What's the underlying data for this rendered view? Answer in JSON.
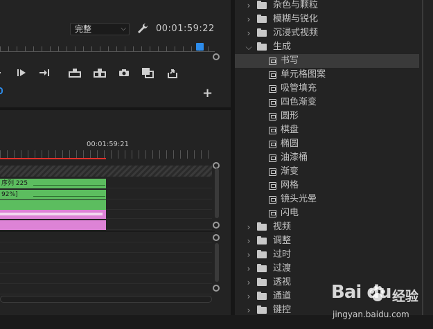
{
  "program_monitor": {
    "fit_value": "完整",
    "timecode": "00:01:59:22"
  },
  "timeline": {
    "timecode": "00:01:59:21",
    "video_clip_label": "序列 225",
    "video_clip_label2": "92%]"
  },
  "effects_tree": {
    "items": [
      {
        "label": "杂色与颗粒",
        "type": "folder",
        "expanded": false
      },
      {
        "label": "模糊与锐化",
        "type": "folder",
        "expanded": false
      },
      {
        "label": "沉浸式视频",
        "type": "folder",
        "expanded": false
      },
      {
        "label": "生成",
        "type": "folder",
        "expanded": true
      },
      {
        "label": "书写",
        "type": "effect",
        "selected": true
      },
      {
        "label": "单元格图案",
        "type": "effect"
      },
      {
        "label": "吸管填充",
        "type": "effect"
      },
      {
        "label": "四色渐变",
        "type": "effect"
      },
      {
        "label": "圆形",
        "type": "effect"
      },
      {
        "label": "棋盘",
        "type": "effect"
      },
      {
        "label": "椭圆",
        "type": "effect"
      },
      {
        "label": "油漆桶",
        "type": "effect"
      },
      {
        "label": "渐变",
        "type": "effect"
      },
      {
        "label": "网格",
        "type": "effect"
      },
      {
        "label": "镜头光晕",
        "type": "effect"
      },
      {
        "label": "闪电",
        "type": "effect"
      },
      {
        "label": "视频",
        "type": "folder",
        "expanded": false
      },
      {
        "label": "调整",
        "type": "folder",
        "expanded": false
      },
      {
        "label": "过时",
        "type": "folder",
        "expanded": false
      },
      {
        "label": "过渡",
        "type": "folder",
        "expanded": false
      },
      {
        "label": "透视",
        "type": "folder",
        "expanded": false
      },
      {
        "label": "通道",
        "type": "folder",
        "expanded": false
      },
      {
        "label": "键控",
        "type": "folder",
        "expanded": false
      }
    ]
  },
  "watermark": {
    "logo": "Bai du",
    "cn": "经验",
    "url": "jingyan.baidu.com"
  },
  "colors": {
    "playhead_blue": "#2d8ceb",
    "timeline_red": "#e0302a",
    "video_clip_green": "#5cbd5f",
    "audio_clip_pink": "#dd83d6"
  }
}
